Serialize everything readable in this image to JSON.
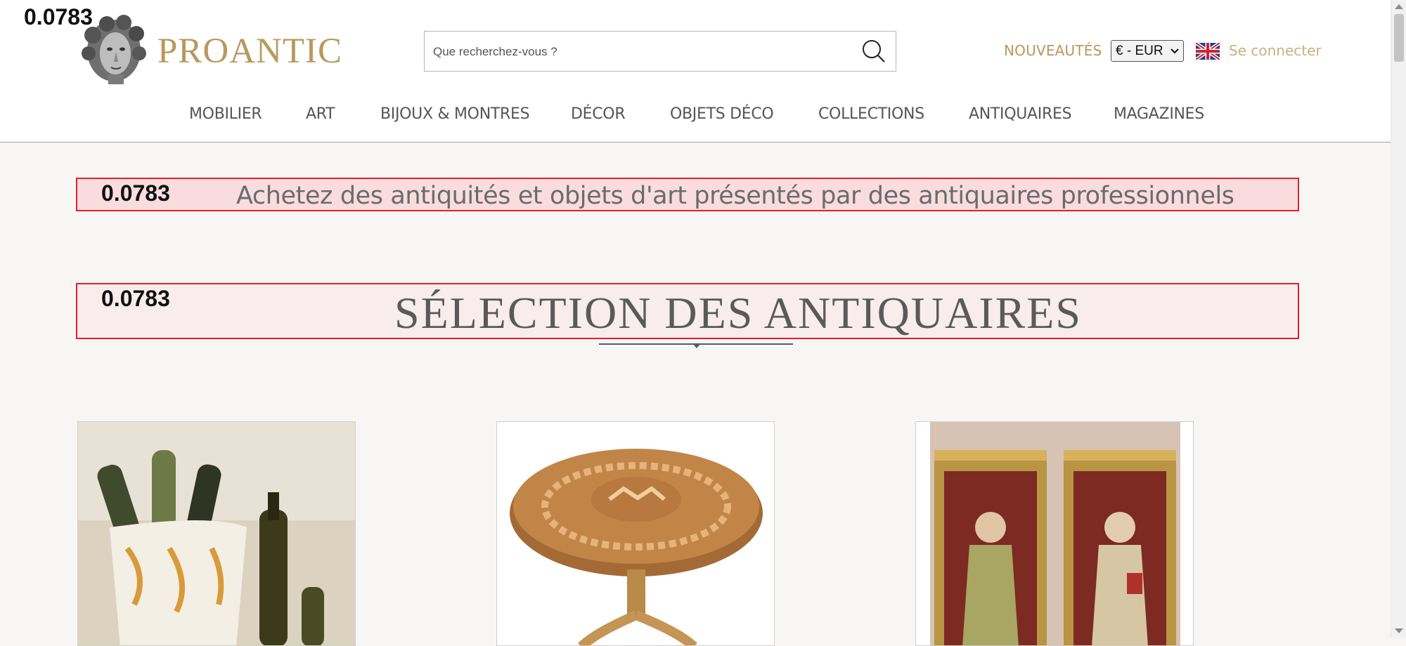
{
  "overlay": {
    "score": "0.0783"
  },
  "header": {
    "logo_text": "PROANTIC",
    "search_placeholder": "Que recherchez-vous ?",
    "nouveautes": "NOUVEAUTÉS",
    "currency": "€ - EUR",
    "login": "Se connecter",
    "flag_icon": "uk-flag-icon"
  },
  "nav": {
    "items": [
      {
        "label": "MOBILIER"
      },
      {
        "label": "ART"
      },
      {
        "label": "BIJOUX & MONTRES"
      },
      {
        "label": "DÉCOR"
      },
      {
        "label": "OBJETS DÉCO"
      },
      {
        "label": "COLLECTIONS"
      },
      {
        "label": "ANTIQUAIRES"
      },
      {
        "label": "MAGAZINES"
      }
    ]
  },
  "main": {
    "tagline": "Achetez des antiquités et objets d'art présentés par des antiquaires professionnels",
    "section_title": "SÉLECTION DES ANTIQUAIRES"
  },
  "colors": {
    "gold": "#b8985d",
    "highlight_border": "#e0202a",
    "divider": "#4a5e75"
  }
}
